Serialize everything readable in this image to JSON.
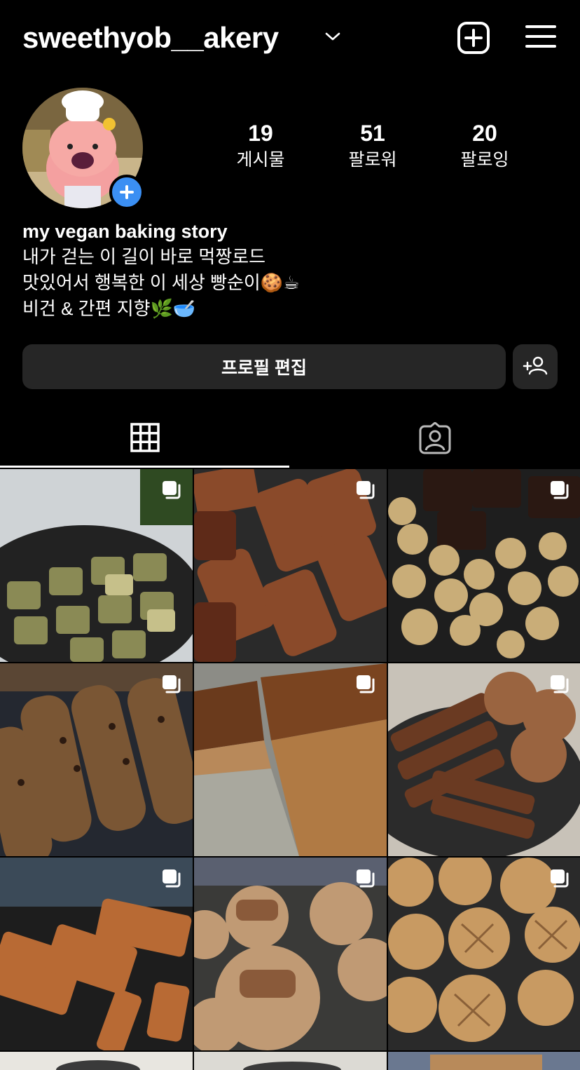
{
  "header": {
    "username": "sweethyob__akery",
    "username_dropdown_icon": "chevron-down-icon",
    "new_post_icon": "plus-square-icon",
    "menu_icon": "hamburger-menu-icon"
  },
  "profile": {
    "avatar_icon": "profile-avatar",
    "add_story_icon": "plus-circle-icon",
    "stats": [
      {
        "value": "19",
        "label": "게시물"
      },
      {
        "value": "51",
        "label": "팔로워"
      },
      {
        "value": "20",
        "label": "팔로잉"
      }
    ],
    "bio": {
      "name": "my vegan baking story",
      "lines": [
        "내가 걷는 이 길이 바로 먹짱로드",
        "맛있어서 행복한 이 세상 빵순이🍪☕",
        "비건 & 간편 지향🌿🥣"
      ]
    },
    "edit_profile_label": "프로필 편집",
    "discover_people_icon": "add-person-icon"
  },
  "tabs": [
    {
      "name": "grid",
      "icon": "grid-icon",
      "active": true
    },
    {
      "name": "tagged",
      "icon": "tagged-person-icon",
      "active": false
    }
  ],
  "colors": {
    "background": "#000000",
    "button": "#262626",
    "accent_blue": "#3b8ff3"
  },
  "posts": [
    {
      "subject": "matcha cookies",
      "multi": true
    },
    {
      "subject": "financiers",
      "multi": true
    },
    {
      "subject": "brownies and cookies",
      "multi": true
    },
    {
      "subject": "chocolate chip biscotti",
      "multi": true
    },
    {
      "subject": "sliced cake",
      "multi": true
    },
    {
      "subject": "biscotti and cookies",
      "multi": true
    },
    {
      "subject": "bars on rack",
      "multi": true
    },
    {
      "subject": "large cookies",
      "multi": true
    },
    {
      "subject": "scored cookies",
      "multi": true
    }
  ]
}
